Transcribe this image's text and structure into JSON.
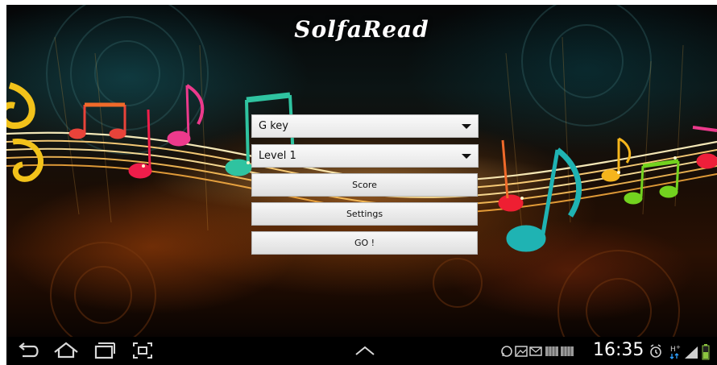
{
  "app": {
    "title": "SolfaRead"
  },
  "controls": {
    "key_select": {
      "value": "G key"
    },
    "level_select": {
      "value": "Level 1"
    },
    "score_button": "Score",
    "settings_button": "Settings",
    "go_button": "GO !"
  },
  "system_bar": {
    "nav_icons": [
      "back-icon",
      "home-icon",
      "recent-apps-icon",
      "screenshot-icon"
    ],
    "center_icon": "chevron-up-icon",
    "status_icons": [
      "whatsapp-icon",
      "gallery-icon",
      "email-icon",
      "keyboard-icon",
      "keyboard-icon",
      "alarm-icon",
      "hspa-icon",
      "signal-icon",
      "battery-icon"
    ],
    "time": "16:35"
  },
  "colors": {
    "nav_bar": "#000000",
    "button_face": "#eeeeee",
    "title_text": "#ffffff"
  }
}
